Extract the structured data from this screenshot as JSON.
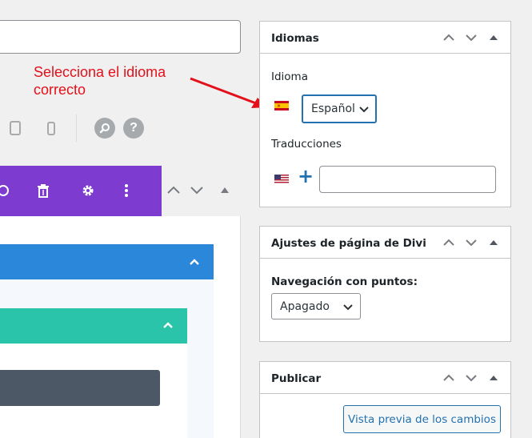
{
  "annotation": {
    "line1": "Selecciona el idioma",
    "line2": "correcto"
  },
  "toolbar": {
    "zoom_icon": "zoom-icon",
    "help_label": "?"
  },
  "builder": {
    "section_colors": {
      "purple": "#7e3bd0",
      "blue": "#2b87da",
      "green": "#29c4a9",
      "dark": "#4c5866"
    }
  },
  "idiomas": {
    "title": "Idiomas",
    "language_label": "Idioma",
    "selected_language": "Español",
    "translations_label": "Traducciones",
    "add_symbol": "+",
    "translation_value": ""
  },
  "divi": {
    "title": "Ajustes de página de Divi",
    "dot_nav_label": "Navegación con puntos:",
    "dot_nav_value": "Apagado"
  },
  "publicar": {
    "title": "Publicar",
    "preview_button": "Vista previa de los cambios"
  },
  "colors": {
    "accent": "#2271b1",
    "annotation": "#e3101a"
  }
}
